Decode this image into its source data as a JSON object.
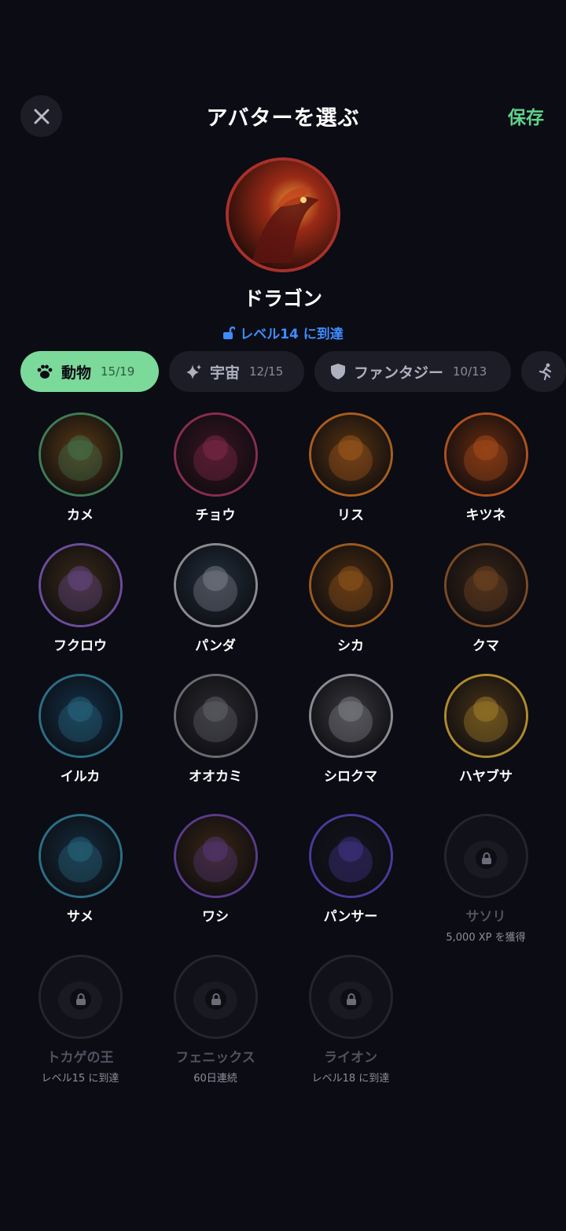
{
  "header": {
    "title": "アバターを選ぶ",
    "save_label": "保存"
  },
  "selected": {
    "name": "ドラゴン",
    "requirement": "レベル14 に到達"
  },
  "tabs": [
    {
      "label": "動物",
      "count": "15/19",
      "icon": "paw-icon",
      "active": true
    },
    {
      "label": "宇宙",
      "count": "12/15",
      "icon": "sparkle-icon",
      "active": false
    },
    {
      "label": "ファンタジー",
      "count": "10/13",
      "icon": "shield-icon",
      "active": false
    },
    {
      "label": "",
      "count": "",
      "icon": "running-icon",
      "active": false
    }
  ],
  "avatars": [
    {
      "name": "カメ",
      "ring": "#3f7c55",
      "bg": "#5a3a14",
      "locked": false
    },
    {
      "name": "チョウ",
      "ring": "#8a2c4f",
      "bg": "#3a1420",
      "locked": false
    },
    {
      "name": "リス",
      "ring": "#a85d1f",
      "bg": "#5a3410",
      "locked": false
    },
    {
      "name": "キツネ",
      "ring": "#b0501c",
      "bg": "#6a2c0e",
      "locked": false
    },
    {
      "name": "フクロウ",
      "ring": "#6c4c9a",
      "bg": "#3a2a18",
      "locked": false
    },
    {
      "name": "パンダ",
      "ring": "#8a8a92",
      "bg": "#23303e",
      "locked": false
    },
    {
      "name": "シカ",
      "ring": "#9a5a1c",
      "bg": "#4a2c10",
      "locked": false
    },
    {
      "name": "クマ",
      "ring": "#7a4a24",
      "bg": "#3a2616",
      "locked": false
    },
    {
      "name": "イルカ",
      "ring": "#2a6f86",
      "bg": "#12314a",
      "locked": false
    },
    {
      "name": "オオカミ",
      "ring": "#6a6a72",
      "bg": "#2a2a30",
      "locked": false
    },
    {
      "name": "シロクマ",
      "ring": "#8a8a92",
      "bg": "#3a3a3e",
      "locked": false
    },
    {
      "name": "ハヤブサ",
      "ring": "#b08a2a",
      "bg": "#4a3418",
      "locked": false
    },
    {
      "name": "サメ",
      "ring": "#2a6f86",
      "bg": "#142c3e",
      "locked": false
    },
    {
      "name": "ワシ",
      "ring": "#5a3a8a",
      "bg": "#3a2614",
      "locked": false
    },
    {
      "name": "パンサー",
      "ring": "#4a3a9a",
      "bg": "#141420",
      "locked": false
    },
    {
      "name": "サソリ",
      "requirement": "5,000 XP を獲得",
      "locked": true
    },
    {
      "name": "トカゲの王",
      "requirement": "レベル15 に到達",
      "locked": true
    },
    {
      "name": "フェニックス",
      "requirement": "60日連続",
      "locked": true
    },
    {
      "name": "ライオン",
      "requirement": "レベル18 に到達",
      "locked": true
    }
  ],
  "colors": {
    "accent": "#7bd99a",
    "save": "#5fd38a",
    "requirement_blue": "#3f8cff",
    "background": "#0b0c14"
  }
}
